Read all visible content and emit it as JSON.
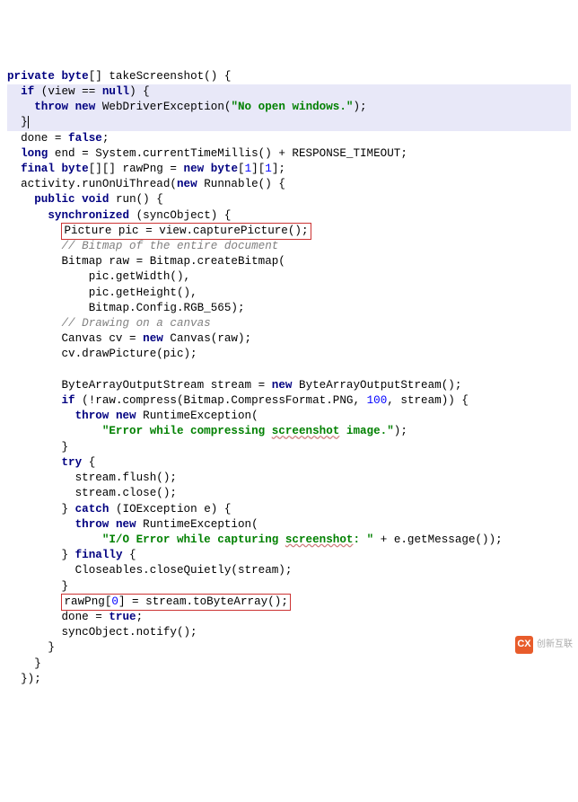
{
  "colors": {
    "keyword": "#000080",
    "string": "#008000",
    "comment": "#808080",
    "number": "#0000ff",
    "highlight_bg": "#e8e8f8",
    "box_border": "#cc3333"
  },
  "code": {
    "l01_kw_private": "private",
    "l01_kw_byte": "byte",
    "l01_rest": "[] takeScreenshot() {",
    "l02_kw_if": "if",
    "l02_txt": " (view == ",
    "l02_kw_null": "null",
    "l02_close": ") {",
    "l03_kw_throw": "throw",
    "l03_kw_new": "new",
    "l03_txt": " WebDriverException(",
    "l03_str": "\"No open windows.\"",
    "l03_close": ");",
    "l04_brace": "}",
    "l05_txt": "done = ",
    "l05_kw_false": "false",
    "l05_close": ";",
    "l06_kw_long": "long",
    "l06_txt": " end = System.currentTimeMillis() + RESPONSE_TIMEOUT;",
    "l07_kw_final": "final",
    "l07_kw_byte": "byte",
    "l07_txt": "[][] rawPng = ",
    "l07_kw_new": "new",
    "l07_kw_byte2": "byte",
    "l07_open": "[",
    "l07_num1": "1",
    "l07_mid": "][",
    "l07_num2": "1",
    "l07_close": "];",
    "l08_txt": "activity.runOnUiThread(",
    "l08_kw_new": "new",
    "l08_txt2": " Runnable() {",
    "l09_kw_public": "public",
    "l09_kw_void": "void",
    "l09_txt": " run() {",
    "l10_kw_sync": "synchronized",
    "l10_txt": " (syncObject) {",
    "l11_txt": "Picture pic = view.capturePicture();",
    "l12_cmt": "// Bitmap of the entire document",
    "l13_txt": "Bitmap raw = Bitmap.createBitmap(",
    "l14_txt": "pic.getWidth(),",
    "l15_txt": "pic.getHeight(),",
    "l16_txt": "Bitmap.Config.RGB_565);",
    "l17_cmt": "// Drawing on a canvas",
    "l18_txt1": "Canvas cv = ",
    "l18_kw_new": "new",
    "l18_txt2": " Canvas(raw);",
    "l19_txt": "cv.drawPicture(pic);",
    "l20_blank": "",
    "l21_txt1": "ByteArrayOutputStream stream = ",
    "l21_kw_new": "new",
    "l21_txt2": " ByteArrayOutputStream();",
    "l22_kw_if": "if",
    "l22_txt": " (!raw.compress(Bitmap.CompressFormat.PNG, ",
    "l22_num": "100",
    "l22_close": ", stream)) {",
    "l23_kw_throw": "throw",
    "l23_kw_new": "new",
    "l23_txt": " RuntimeException(",
    "l24_str_a": "\"Error while compressing ",
    "l24_str_err": "screenshot",
    "l24_str_b": " image.\"",
    "l24_close": ");",
    "l25_brace": "}",
    "l26_kw_try": "try",
    "l26_brace": " {",
    "l27_txt": "stream.flush();",
    "l28_txt": "stream.close();",
    "l29_brace": "} ",
    "l29_kw_catch": "catch",
    "l29_txt": " (IOException e) {",
    "l30_kw_throw": "throw",
    "l30_kw_new": "new",
    "l30_txt": " RuntimeException(",
    "l31_str_a": "\"I/O Error while capturing ",
    "l31_str_err": "screenshot",
    "l31_str_b": ": \"",
    "l31_txt": " + e.getMessage());",
    "l32_brace": "} ",
    "l32_kw_finally": "finally",
    "l32_txt": " {",
    "l33_txt": "Closeables.closeQuietly(stream);",
    "l34_brace": "}",
    "l35_txt1": "rawPng[",
    "l35_num": "0",
    "l35_txt2": "] = stream.toByteArray();",
    "l36_txt": "done = ",
    "l36_kw_true": "true",
    "l36_close": ";",
    "l37_txt": "syncObject.notify();",
    "l38_brace": "}",
    "l39_brace": "}",
    "l40_close": "});"
  },
  "logo_text": "创新互联"
}
